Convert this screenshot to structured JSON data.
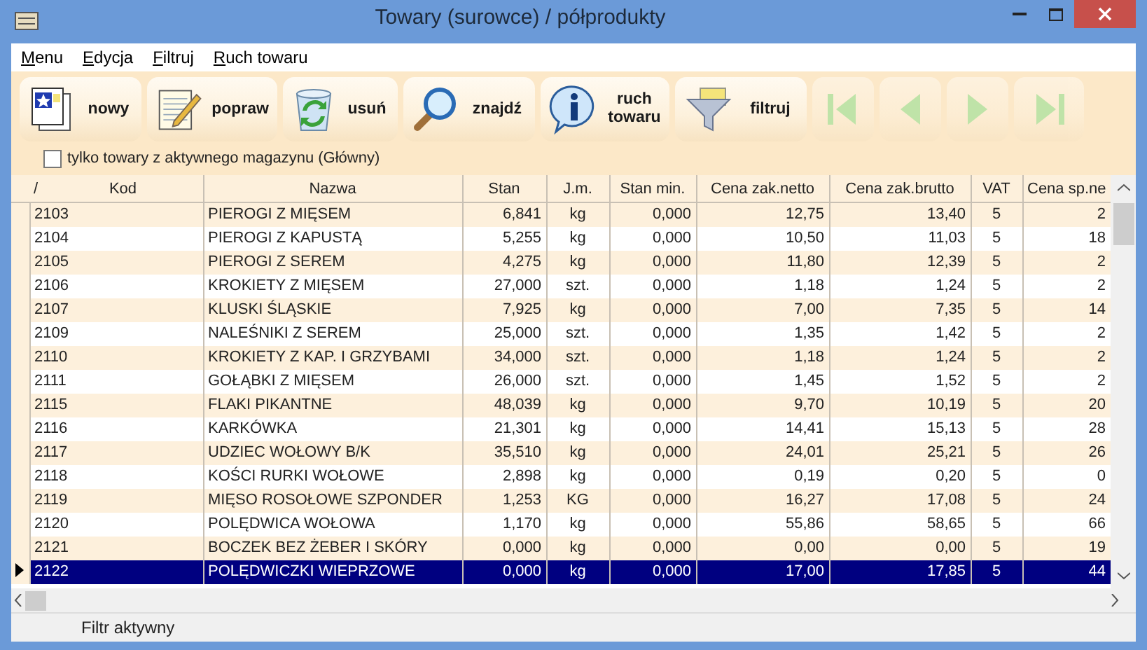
{
  "window": {
    "title": "Towary (surowce) / półprodukty"
  },
  "menu": [
    {
      "label": "Menu"
    },
    {
      "label": "Edycja"
    },
    {
      "label": "Filtruj"
    },
    {
      "label": "Ruch towaru"
    }
  ],
  "toolbar": [
    {
      "kind": "new",
      "label": "nowy"
    },
    {
      "kind": "edit",
      "label": "popraw"
    },
    {
      "kind": "delete",
      "label": "usuń"
    },
    {
      "kind": "find",
      "label": "znajdź"
    },
    {
      "kind": "info",
      "label": "ruch towaru"
    },
    {
      "kind": "filter",
      "label": "filtruj"
    }
  ],
  "navigation": [
    {
      "kind": "first",
      "disabled": true
    },
    {
      "kind": "prev",
      "disabled": true
    },
    {
      "kind": "next",
      "disabled": true
    },
    {
      "kind": "last",
      "disabled": true
    }
  ],
  "checkbox": {
    "label": "tylko towary z aktywnego magazynu (Główny)",
    "checked": false
  },
  "table": {
    "sort_mark": "/",
    "columns": [
      {
        "label": "Kod"
      },
      {
        "label": "Nazwa"
      },
      {
        "label": "Stan"
      },
      {
        "label": "J.m."
      },
      {
        "label": "Stan min."
      },
      {
        "label": "Cena zak.netto"
      },
      {
        "label": "Cena zak.brutto"
      },
      {
        "label": "VAT"
      },
      {
        "label": "Cena sp.ne"
      }
    ],
    "rows": [
      {
        "selected": false,
        "cells": [
          "2103",
          "PIEROGI Z MIĘSEM",
          "6,841",
          "kg",
          "0,000",
          "12,75",
          "13,40",
          "5",
          "2"
        ]
      },
      {
        "selected": false,
        "cells": [
          "2104",
          "PIEROGI Z KAPUSTĄ",
          "5,255",
          "kg",
          "0,000",
          "10,50",
          "11,03",
          "5",
          "18"
        ]
      },
      {
        "selected": false,
        "cells": [
          "2105",
          "PIEROGI Z SEREM",
          "4,275",
          "kg",
          "0,000",
          "11,80",
          "12,39",
          "5",
          "2"
        ]
      },
      {
        "selected": false,
        "cells": [
          "2106",
          "KROKIETY Z MIĘSEM",
          "27,000",
          "szt.",
          "0,000",
          "1,18",
          "1,24",
          "5",
          "2"
        ]
      },
      {
        "selected": false,
        "cells": [
          "2107",
          "KLUSKI ŚLĄSKIE",
          "7,925",
          "kg",
          "0,000",
          "7,00",
          "7,35",
          "5",
          "14"
        ]
      },
      {
        "selected": false,
        "cells": [
          "2109",
          "NALEŚNIKI Z SEREM",
          "25,000",
          "szt.",
          "0,000",
          "1,35",
          "1,42",
          "5",
          "2"
        ]
      },
      {
        "selected": false,
        "cells": [
          "2110",
          "KROKIETY Z KAP. I GRZYBAMI",
          "34,000",
          "szt.",
          "0,000",
          "1,18",
          "1,24",
          "5",
          "2"
        ]
      },
      {
        "selected": false,
        "cells": [
          "2111",
          "GOŁĄBKI Z MIĘSEM",
          "26,000",
          "szt.",
          "0,000",
          "1,45",
          "1,52",
          "5",
          "2"
        ]
      },
      {
        "selected": false,
        "cells": [
          "2115",
          "FLAKI PIKANTNE",
          "48,039",
          "kg",
          "0,000",
          "9,70",
          "10,19",
          "5",
          "20"
        ]
      },
      {
        "selected": false,
        "cells": [
          "2116",
          "KARKÓWKA",
          "21,301",
          "kg",
          "0,000",
          "14,41",
          "15,13",
          "5",
          "28"
        ]
      },
      {
        "selected": false,
        "cells": [
          "2117",
          "UDZIEC WOŁOWY B/K",
          "35,510",
          "kg",
          "0,000",
          "24,01",
          "25,21",
          "5",
          "26"
        ]
      },
      {
        "selected": false,
        "cells": [
          "2118",
          "KOŚCI RURKI WOŁOWE",
          "2,898",
          "kg",
          "0,000",
          "0,19",
          "0,20",
          "5",
          "0"
        ]
      },
      {
        "selected": false,
        "cells": [
          "2119",
          "MIĘSO ROSOŁOWE SZPONDER",
          "1,253",
          "KG",
          "0,000",
          "16,27",
          "17,08",
          "5",
          "24"
        ]
      },
      {
        "selected": false,
        "cells": [
          "2120",
          "POLĘDWICA WOŁOWA",
          "1,170",
          "kg",
          "0,000",
          "55,86",
          "58,65",
          "5",
          "66"
        ]
      },
      {
        "selected": false,
        "cells": [
          "2121",
          "BOCZEK BEZ ŻEBER I SKÓRY",
          "0,000",
          "kg",
          "0,000",
          "0,00",
          "0,00",
          "5",
          "19"
        ]
      },
      {
        "selected": true,
        "cells": [
          "2122",
          "POLĘDWICZKI WIEPRZOWE",
          "0,000",
          "kg",
          "0,000",
          "17,00",
          "17,85",
          "5",
          "44"
        ]
      }
    ]
  },
  "status_bar": {
    "text": "Filtr aktywny"
  }
}
